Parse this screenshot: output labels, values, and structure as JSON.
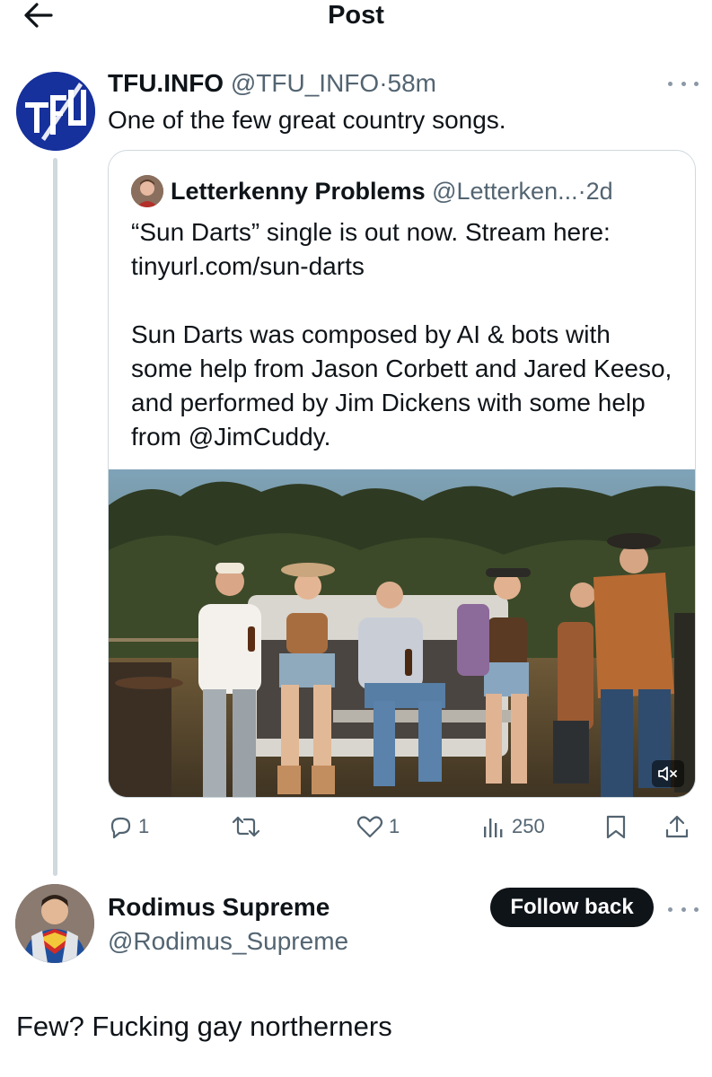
{
  "header": {
    "title": "Post",
    "back_icon": "arrow-left-icon"
  },
  "tweet": {
    "author_name": "TFU.INFO",
    "author_handle": "@TFU_INFO",
    "separator": "·",
    "time": "58m",
    "text": "One of the few great country songs.",
    "avatar_logo_text": "TFU",
    "quote": {
      "author_name": "Letterkenny Problems",
      "author_handle": "@Letterken...",
      "separator": "·",
      "time": "2d",
      "text": "“Sun Darts” single is out now. Stream here: tinyurl.com/sun-darts\n\nSun Darts was composed by AI & bots with some help from Jason Corbett and Jared Keeso, and performed by Jim Dickens with some help from @JimCuddy.",
      "media_icon": "volume-mute-icon"
    },
    "actions": {
      "reply_count": "1",
      "retweet_count": "",
      "like_count": "1",
      "views_count": "250"
    }
  },
  "reply": {
    "author_name": "Rodimus Supreme",
    "author_handle": "@Rodimus_Supreme",
    "follow_label": "Follow back",
    "text": "Few? Fucking gay northerners"
  },
  "colors": {
    "text": "#0f1419",
    "muted": "#536471",
    "border": "#cfd9de",
    "brand_blue": "#16309c",
    "button_bg": "#0f1419"
  }
}
